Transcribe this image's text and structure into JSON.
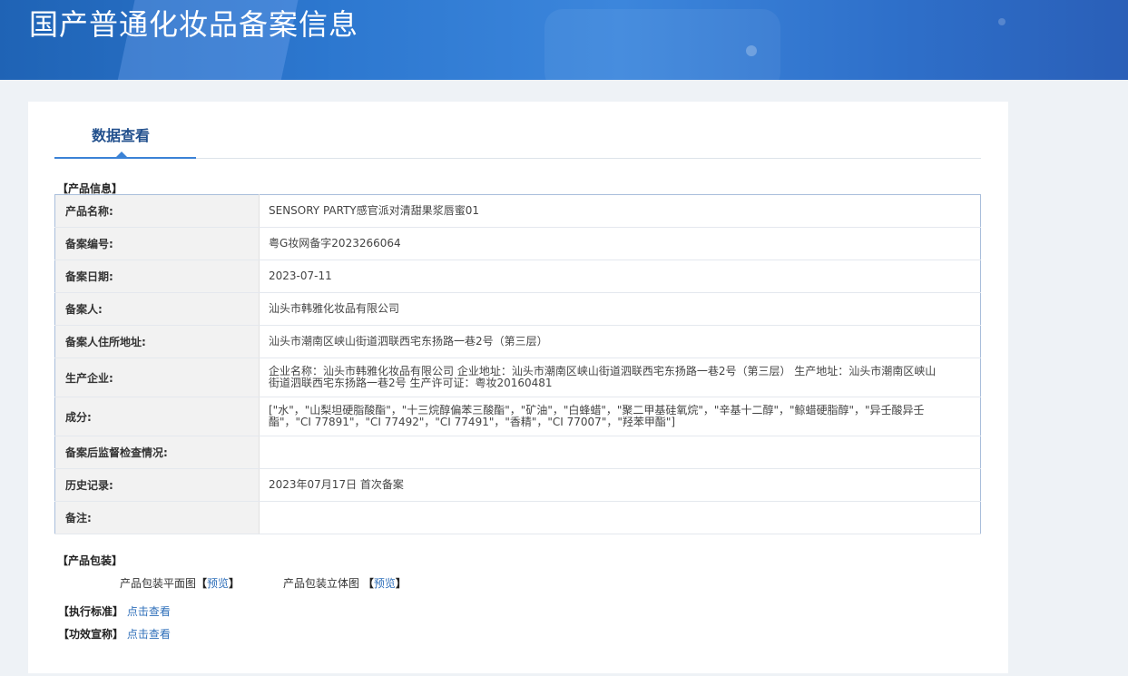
{
  "header": {
    "title": "国产普通化妆品备案信息"
  },
  "tabs": [
    {
      "label": "数据查看"
    }
  ],
  "product_info": {
    "section_title": "【产品信息】",
    "rows": [
      {
        "label": "产品名称:",
        "value": "SENSORY PARTY感官派对清甜果浆唇蜜01"
      },
      {
        "label": "备案编号:",
        "value": "粤G妆网备字2023266064"
      },
      {
        "label": "备案日期:",
        "value": "2023-07-11"
      },
      {
        "label": "备案人:",
        "value": "汕头市韩雅化妆品有限公司"
      },
      {
        "label": "备案人住所地址:",
        "value": "汕头市潮南区峡山街道泗联西宅东扬路一巷2号（第三层）"
      },
      {
        "label": "生产企业:",
        "value": "企业名称：汕头市韩雅化妆品有限公司 企业地址：汕头市潮南区峡山街道泗联西宅东扬路一巷2号（第三层） 生产地址：汕头市潮南区峡山街道泗联西宅东扬路一巷2号 生产许可证：粤妆20160481"
      },
      {
        "label": "成分:",
        "value": "[\"水\"，\"山梨坦硬脂酸酯\"，\"十三烷醇偏苯三酸酯\"，\"矿油\"，\"白蜂蜡\"，\"聚二甲基硅氧烷\"，\"辛基十二醇\"，\"鲸蜡硬脂醇\"，\"异壬酸异壬酯\"，\"CI 77891\"，\"CI 77492\"，\"CI 77491\"，\"香精\"，\"CI 77007\"，\"羟苯甲酯\"]"
      },
      {
        "label": "备案后监督检查情况:",
        "value": ""
      },
      {
        "label": "历史记录:",
        "value": "2023年07月17日 首次备案"
      },
      {
        "label": "备注:",
        "value": ""
      }
    ]
  },
  "packaging": {
    "section_title": "【产品包装】",
    "flat_label": "产品包装平面图",
    "solid_label": "产品包装立体图",
    "preview_link": "预览",
    "bracket_open": "【",
    "bracket_close": "】"
  },
  "standard": {
    "label": "【执行标准】",
    "link": "点击查看"
  },
  "efficacy": {
    "label": "【功效宣称】",
    "link": "点击查看"
  },
  "colors": {
    "banner": "#2d78d0",
    "tab_accent": "#3b82d6",
    "link": "#2f6fba",
    "table_border": "#a9bedb"
  }
}
